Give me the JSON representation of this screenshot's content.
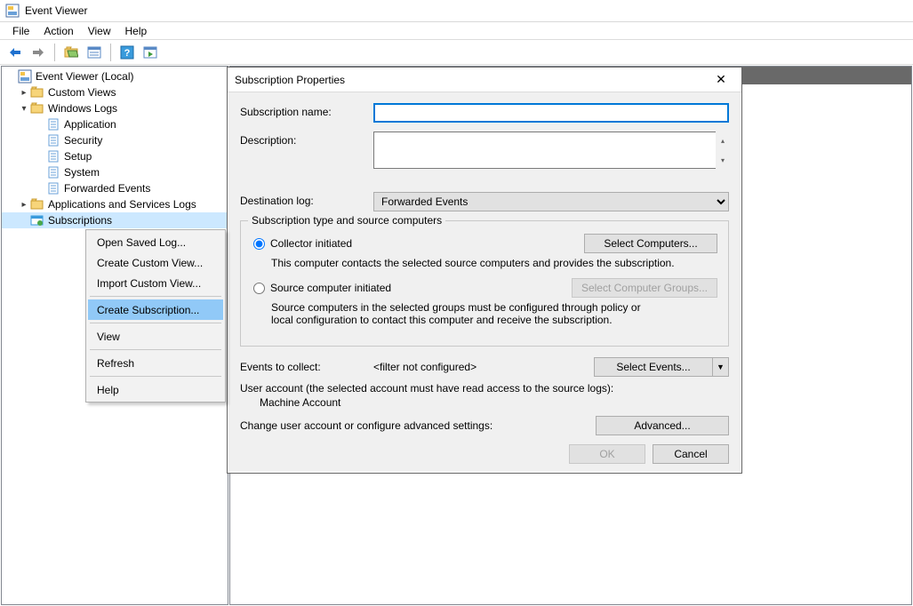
{
  "titlebar": {
    "title": "Event Viewer"
  },
  "menubar": {
    "file": "File",
    "action": "Action",
    "view": "View",
    "help": "Help"
  },
  "tree": {
    "root": "Event Viewer (Local)",
    "custom_views": "Custom Views",
    "windows_logs": "Windows Logs",
    "application": "Application",
    "security": "Security",
    "setup": "Setup",
    "system": "System",
    "forwarded": "Forwarded Events",
    "apps_services": "Applications and Services Logs",
    "subscriptions": "Subscriptions"
  },
  "ctx": {
    "open_saved": "Open Saved Log...",
    "create_custom": "Create Custom View...",
    "import_custom": "Import Custom View...",
    "create_sub": "Create Subscription...",
    "view": "View",
    "refresh": "Refresh",
    "help": "Help"
  },
  "dialog": {
    "title": "Subscription Properties",
    "sub_name_label": "Subscription name:",
    "sub_name_value": "",
    "desc_label": "Description:",
    "desc_value": "",
    "dest_log_label": "Destination log:",
    "dest_log_value": "Forwarded Events",
    "group_legend": "Subscription type and source computers",
    "collector_label": "Collector initiated",
    "collector_desc": "This computer contacts the selected source computers and provides the subscription.",
    "select_computers": "Select Computers...",
    "source_label": "Source computer initiated",
    "source_desc": "Source computers in the selected groups must be configured through policy or local configuration to contact this computer and receive the subscription.",
    "select_groups": "Select Computer Groups...",
    "events_label": "Events to collect:",
    "events_value": "<filter not configured>",
    "select_events": "Select Events...",
    "user_account_label": "User account (the selected account must have read access to the source logs):",
    "machine_account": "Machine Account",
    "advanced_label": "Change user account or configure advanced settings:",
    "advanced_btn": "Advanced...",
    "ok": "OK",
    "cancel": "Cancel"
  }
}
